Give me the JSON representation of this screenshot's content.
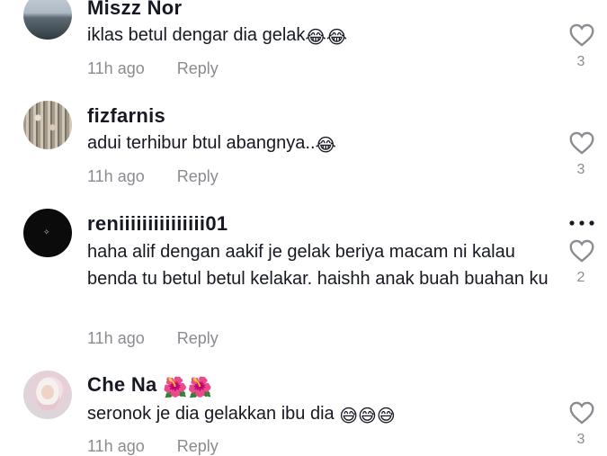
{
  "comments": [
    {
      "username": "Miszz Nor",
      "text": "iklas betul dengar dia gelak",
      "emoji": "😂😂",
      "time": "11h ago",
      "reply_label": "Reply",
      "likes": "3",
      "avatar": "lake-photo"
    },
    {
      "username": "fizfarnis",
      "text": "adui terhibur btul abangnya..",
      "emoji": "😂",
      "time": "11h ago",
      "reply_label": "Reply",
      "likes": "3",
      "avatar": "crowd-photo"
    },
    {
      "username": "reniiiiiiiiiiiiiii01",
      "text": "haha alif dengan aakif je gelak beriya macam ni kalau benda tu betul betul kelakar. haishh anak buah buahan ku",
      "emoji": "",
      "time": "11h ago",
      "reply_label": "Reply",
      "likes": "2",
      "avatar": "dark-logo"
    },
    {
      "username": "Che Na",
      "username_emoji": "🌺🌺",
      "text": "seronok je dia gelakkan ibu dia ",
      "emoji": "😅😅😅",
      "time": "11h ago",
      "reply_label": "Reply",
      "likes": "3",
      "avatar": "hijab-photo"
    }
  ],
  "icons": {
    "like": "heart-outline-icon",
    "more": "more-options-icon"
  },
  "colors": {
    "primary_text": "#161823",
    "secondary_text": "#8a8b91",
    "background": "#ffffff"
  }
}
